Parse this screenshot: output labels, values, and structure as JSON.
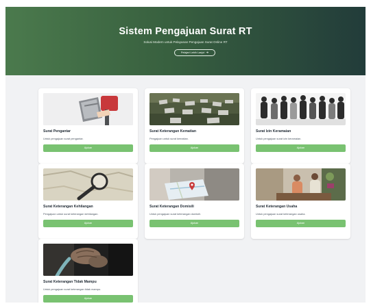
{
  "hero": {
    "title": "Sistem Pengajuan Surat RT",
    "subtitle": "Solusi Modern untuk Pelayanan Pengajuan Surat Online RT",
    "cta_label": "Pelajari Lebih Lanjut",
    "cta_icon": "arrow-right-icon",
    "gradient_colors": [
      "#4b7a4d",
      "#223c3a"
    ]
  },
  "accent_color": "#79c271",
  "services": [
    {
      "title": "Surat Pengantar",
      "description": "Untuk pengajuan surat pengantar.",
      "button_label": "Ajukan",
      "image": "mailbox-photo"
    },
    {
      "title": "Surat Keterangan Kematian",
      "description": "Pengajuan untuk surat kematian.",
      "button_label": "Ajukan",
      "image": "cemetery-photo"
    },
    {
      "title": "Surat Izin Keramaian",
      "description": "Untuk pengajuan surat izin keramaian.",
      "button_label": "Ajukan",
      "image": "crowd-photo"
    },
    {
      "title": "Surat Keterangan Kehilangan",
      "description": "Pengajuan untuk surat keterangan kehilangan.",
      "button_label": "Ajukan",
      "image": "magnifier-photo"
    },
    {
      "title": "Surat Keterangan Domisili",
      "description": "Untuk pengajuan surat keterangan domisili.",
      "button_label": "Ajukan",
      "image": "map-pin-photo"
    },
    {
      "title": "Surat Keterangan Usaha",
      "description": "Untuk pengajuan surat keterangan usaha.",
      "button_label": "Ajukan",
      "image": "shop-owner-photo"
    },
    {
      "title": "Surat Keterangan Tidak Mampu",
      "description": "Untuk pengajuan surat keterangan tidak mampu.",
      "button_label": "Ajukan",
      "image": "elderly-hands-photo"
    }
  ]
}
